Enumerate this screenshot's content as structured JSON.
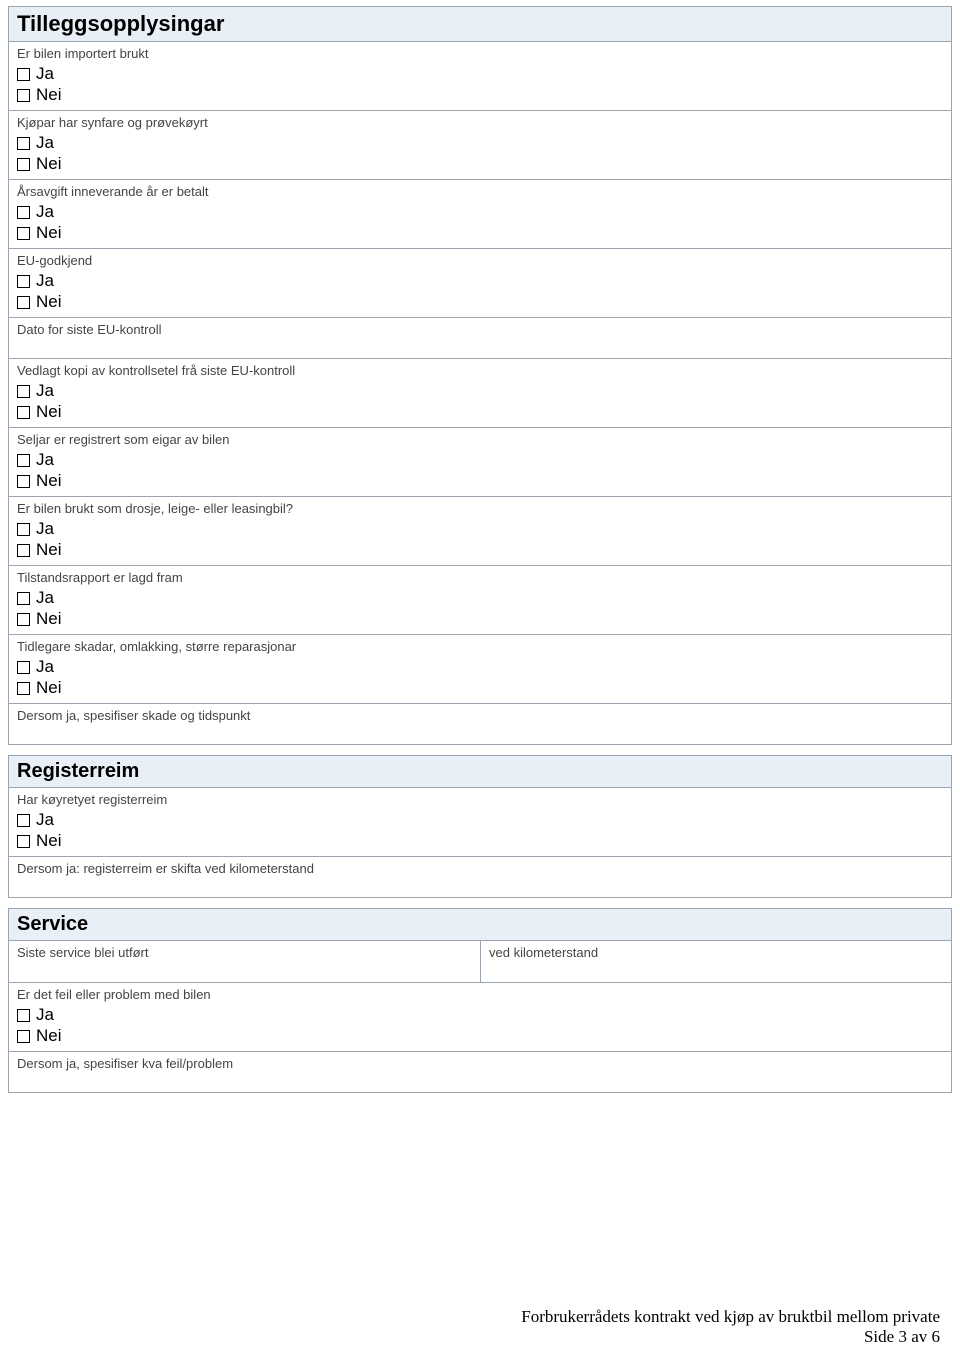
{
  "options": {
    "yes": "Ja",
    "no": "Nei"
  },
  "tillegg": {
    "title": "Tilleggsopplysingar",
    "q1": "Er bilen importert brukt",
    "q2": "Kjøpar har synfare og prøvekøyrt",
    "q3": "Årsavgift inneverande år er betalt",
    "q4": "EU-godkjend",
    "q5": "Dato for siste EU-kontroll",
    "q6": "Vedlagt kopi av kontrollsetel frå siste EU-kontroll",
    "q7": "Seljar er registrert som eigar av bilen",
    "q8": "Er bilen brukt som drosje, leige- eller leasingbil?",
    "q9": "Tilstandsrapport er lagd fram",
    "q10": "Tidlegare skadar, omlakking, større reparasjonar",
    "q11": "Dersom ja, spesifiser skade og tidspunkt"
  },
  "register": {
    "title": "Registerreim",
    "q1": "Har køyretyet registerreim",
    "q2": "Dersom ja: registerreim er skifta ved kilometerstand"
  },
  "service": {
    "title": "Service",
    "q1": "Siste service blei utført",
    "q2": "ved kilometerstand",
    "q3": "Er det feil eller problem med bilen",
    "q4": "Dersom ja, spesifiser kva feil/problem"
  },
  "footer": {
    "line1": "Forbrukerrådets kontrakt ved kjøp av bruktbil mellom private",
    "line2": "Side 3 av 6"
  }
}
